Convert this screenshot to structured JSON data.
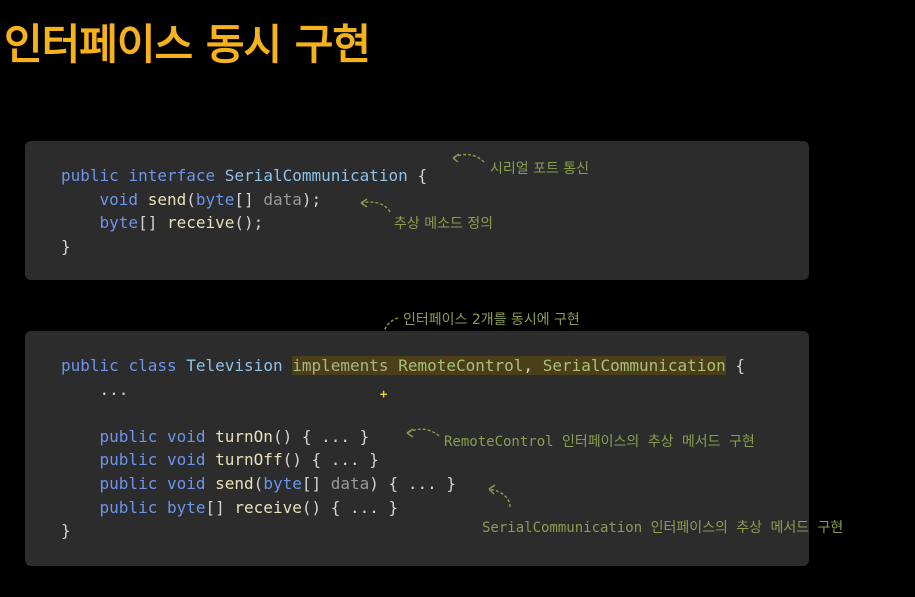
{
  "title": "인터페이스 동시 구현",
  "colors": {
    "title": "#f6b21a",
    "keyword": "#6c95eb",
    "type": "#dcc06b",
    "class": "#8dc3e6",
    "annotation": "#8a9e4e",
    "highlight_bg": "#4a3f18",
    "code_bg": "#2c2c2c"
  },
  "code1": {
    "line1": {
      "public": "public",
      "interface": "interface",
      "name": "SerialCommunication",
      "brace": " {"
    },
    "line2": {
      "indent": "    ",
      "void": "void",
      "fn": "send",
      "open": "(",
      "byte": "byte",
      "arr": "[] ",
      "param": "data",
      "close": ");"
    },
    "line3": {
      "indent": "    ",
      "byte": "byte",
      "rest": "[] ",
      "fn": "receive",
      "close": "();"
    },
    "line4": "}"
  },
  "code2": {
    "line1": {
      "public": "public",
      "class": "class",
      "name": "Television",
      "implements": "implements",
      "iface1": "RemoteControl",
      "comma": ", ",
      "iface2": "SerialCommunication",
      "brace": " {"
    },
    "line2": "    ...",
    "line4": {
      "public": "public",
      "void": "void",
      "fn": "turnOn",
      "rest": "() { ... }"
    },
    "line5": {
      "public": "public",
      "void": "void",
      "fn": "turnOff",
      "rest": "() { ... }"
    },
    "line6": {
      "public": "public",
      "void": "void",
      "fn": "send",
      "open": "(",
      "byte": "byte",
      "arr": "[] ",
      "param": "data",
      "rest": ") { ... }"
    },
    "line7": {
      "public": "public",
      "byte": "byte",
      "arr": "[] ",
      "fn": "receive",
      "rest": "() { ... }"
    },
    "line8": "}"
  },
  "annotations": {
    "serial_port": "시리얼 포트 통신",
    "abstract_methods": "추상 메소드 정의",
    "implements_two": "인터페이스 2개를 동시에 구현",
    "remote_impl": "RemoteControl 인터페이스의 추상 메서드 구현",
    "serial_impl": "SerialCommunication 인터페이스의 추상 메서드 구현"
  },
  "icons": {
    "arrow": "curved-dashed-arrow-icon",
    "cursor": "crosshair-cursor-icon",
    "cursor_glyph": "+"
  }
}
